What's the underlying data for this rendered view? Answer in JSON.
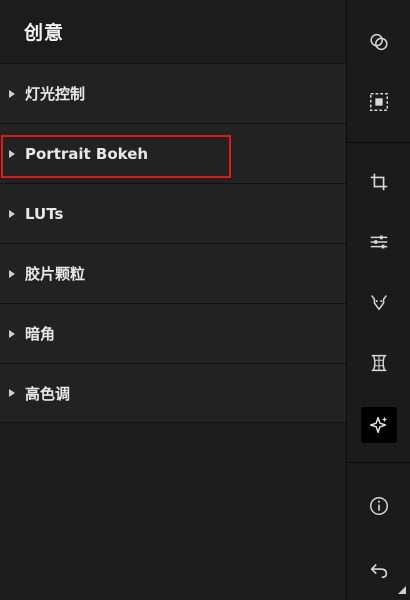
{
  "panel": {
    "title": "创意",
    "sections": [
      {
        "label": "灯光控制"
      },
      {
        "label": "Portrait Bokeh"
      },
      {
        "label": "LUTs"
      },
      {
        "label": "胶片颗粒"
      },
      {
        "label": "暗角"
      },
      {
        "label": "高色调"
      }
    ],
    "highlighted_section": "Portrait Bokeh"
  },
  "toolbar": {
    "tools": [
      {
        "name": "overlap-circles-icon"
      },
      {
        "name": "selection-frame-icon"
      },
      {
        "name": "crop-icon"
      },
      {
        "name": "sliders-icon"
      },
      {
        "name": "face-retouch-icon"
      },
      {
        "name": "grid-frame-icon"
      },
      {
        "name": "sparkle-icon",
        "active": true
      },
      {
        "name": "info-icon"
      },
      {
        "name": "undo-icon"
      }
    ]
  },
  "colors": {
    "highlight_border": "#e01818",
    "panel_bg": "#222222",
    "toolbar_bg": "#1b1b1b"
  }
}
